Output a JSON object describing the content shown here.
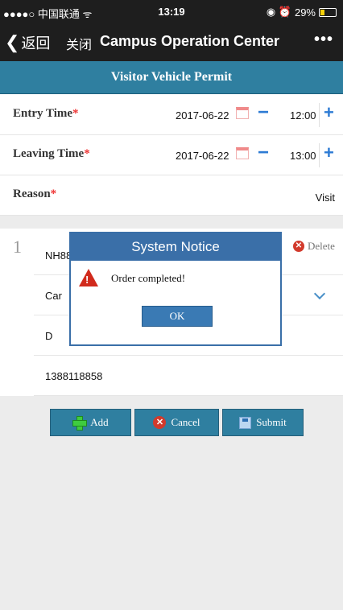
{
  "status_bar": {
    "carrier": "●●●●○ 中国联通 ᯤ",
    "time": "13:19",
    "icons": "◉ ⏰",
    "battery_percent": "29%",
    "battery_level": 0.29
  },
  "nav": {
    "back_label": "返回",
    "close_label": "关闭",
    "title": "Campus Operation Center",
    "more_label": "•••"
  },
  "header": {
    "title": "Visitor Vehicle Permit"
  },
  "form": {
    "entry": {
      "label": "Entry Time",
      "required_mark": "*",
      "date": "2017-06-22",
      "time": "12:00"
    },
    "leaving": {
      "label": "Leaving Time",
      "required_mark": "*",
      "date": "2017-06-22",
      "time": "13:00"
    },
    "reason": {
      "label": "Reason",
      "required_mark": "*",
      "value": "Visit"
    }
  },
  "vehicle": {
    "index": "1",
    "plate": "NH88",
    "type": "Car",
    "field3": "D",
    "phone": "1388118858",
    "delete_label": "Delete"
  },
  "actions": {
    "add_label": "Add",
    "cancel_label": "Cancel",
    "submit_label": "Submit"
  },
  "dialog": {
    "title": "System Notice",
    "message": "Order completed!",
    "ok_label": "OK"
  },
  "colors": {
    "header_blue": "#2f7fa0",
    "dialog_blue": "#3a6fa8",
    "accent_blue": "#2d7bd4",
    "required_red": "#e33333"
  }
}
